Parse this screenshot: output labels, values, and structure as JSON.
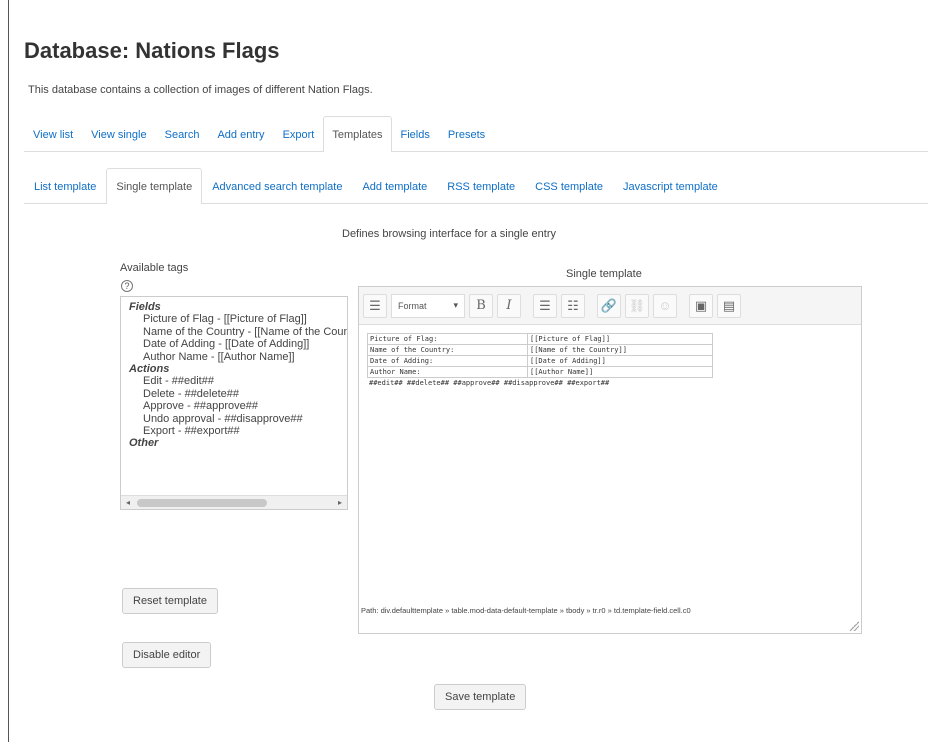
{
  "page": {
    "title": "Database: Nations Flags",
    "description": "This database contains a collection of images of different Nation Flags."
  },
  "main_tabs": [
    {
      "label": "View list",
      "active": false
    },
    {
      "label": "View single",
      "active": false
    },
    {
      "label": "Search",
      "active": false
    },
    {
      "label": "Add entry",
      "active": false
    },
    {
      "label": "Export",
      "active": false
    },
    {
      "label": "Templates",
      "active": true
    },
    {
      "label": "Fields",
      "active": false
    },
    {
      "label": "Presets",
      "active": false
    }
  ],
  "sub_tabs": [
    {
      "label": "List template",
      "active": false
    },
    {
      "label": "Single template",
      "active": true
    },
    {
      "label": "Advanced search template",
      "active": false
    },
    {
      "label": "Add template",
      "active": false
    },
    {
      "label": "RSS template",
      "active": false
    },
    {
      "label": "CSS template",
      "active": false
    },
    {
      "label": "Javascript template",
      "active": false
    }
  ],
  "template_description": "Defines browsing interface for a single entry",
  "available_tags": {
    "label": "Available tags",
    "help_icon": "?",
    "groups": [
      {
        "name": "Fields",
        "items": [
          "Picture of Flag - [[Picture of Flag]]",
          "Name of the Country - [[Name of the Country]]",
          "Date of Adding - [[Date of Adding]]",
          "Author Name - [[Author Name]]"
        ]
      },
      {
        "name": "Actions",
        "items": [
          "Edit - ##edit##",
          "Delete - ##delete##",
          "Approve - ##approve##",
          "Undo approval - ##disapprove##",
          "Export - ##export##"
        ]
      },
      {
        "name": "Other",
        "items": []
      }
    ],
    "scroll_left_icon": "◂",
    "scroll_right_icon": "▸"
  },
  "editor": {
    "label": "Single template",
    "toolbar": {
      "toggle_icon": "☰",
      "format_label": "Format",
      "format_caret": "▾",
      "bold": "B",
      "italic": "I",
      "unordered_list": "☰",
      "ordered_list": "☷",
      "link": "🔗",
      "unlink": "⛓",
      "emoji": "☺",
      "image": "▣",
      "media": "▤"
    },
    "table_rows": [
      {
        "label": "Picture of Flag:",
        "value": "[[Picture of Flag]]"
      },
      {
        "label": "Name of the Country:",
        "value": "[[Name of the Country]]"
      },
      {
        "label": "Date of Adding:",
        "value": "[[Date of Adding]]"
      },
      {
        "label": "Author Name:",
        "value": "[[Author Name]]"
      }
    ],
    "actions_line": "##edit## ##delete## ##approve## ##disapprove## ##export##",
    "path": "Path: div.defaulttemplate » table.mod-data-default-template » tbody » tr.r0 » td.template-field.cell.c0"
  },
  "buttons": {
    "reset": "Reset template",
    "disable": "Disable editor",
    "save": "Save template"
  }
}
